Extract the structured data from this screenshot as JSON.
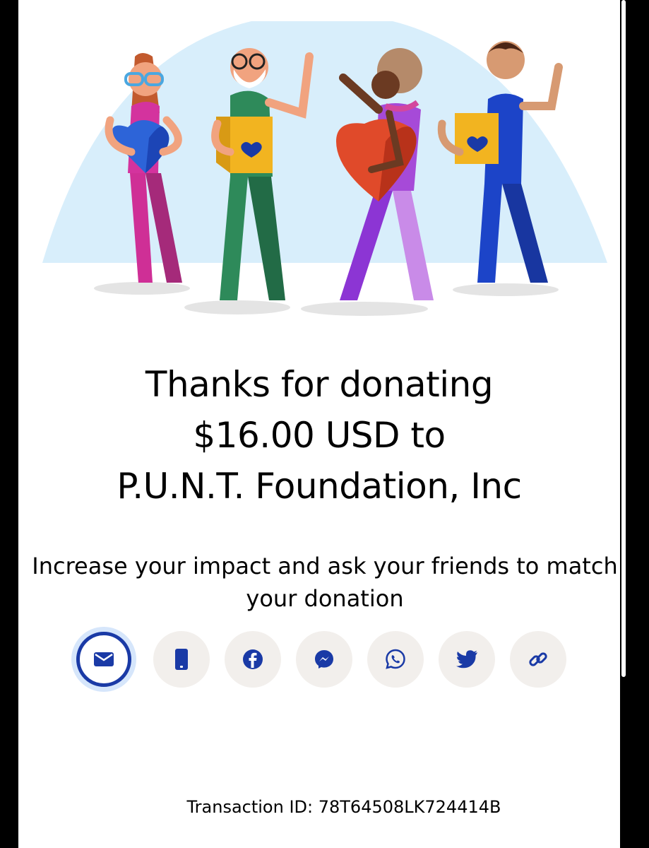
{
  "thanks": {
    "line1": "Thanks for donating",
    "line2": "$16.00 USD to",
    "line3": "P.U.N.T. Foundation, Inc"
  },
  "subtitle": "Increase your impact and ask your friends to match your donation",
  "share_buttons": [
    {
      "icon": "email-icon",
      "active": true
    },
    {
      "icon": "phone-icon",
      "active": false
    },
    {
      "icon": "facebook-icon",
      "active": false
    },
    {
      "icon": "messenger-icon",
      "active": false
    },
    {
      "icon": "whatsapp-icon",
      "active": false
    },
    {
      "icon": "twitter-icon",
      "active": false
    },
    {
      "icon": "link-icon",
      "active": false
    }
  ],
  "transaction": "Transaction ID: 78T64508LK724414B",
  "colors": {
    "accent": "#1a3aa6",
    "button_bg": "#f2efec",
    "active_ring": "#d6e6fb",
    "hero_sky": "#d8eefb"
  }
}
